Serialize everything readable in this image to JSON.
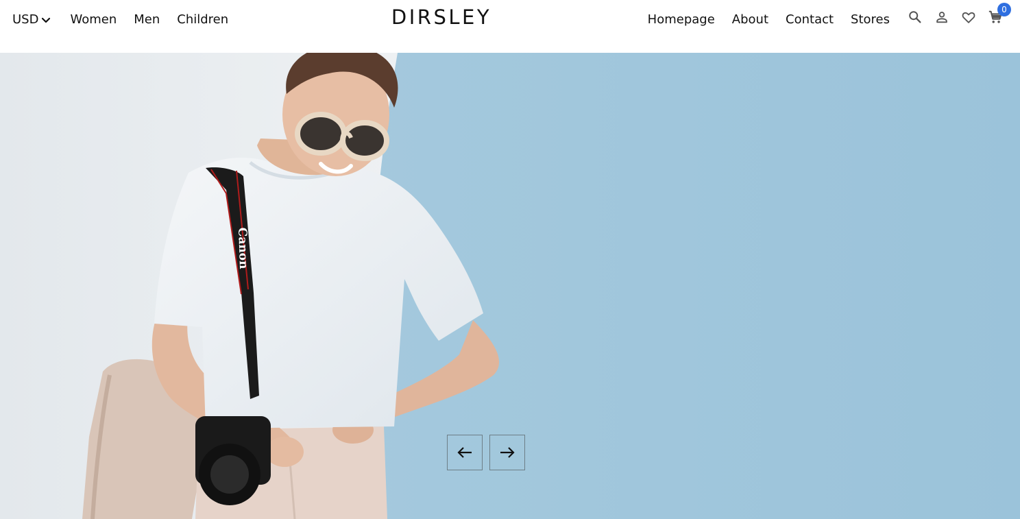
{
  "header": {
    "currency": {
      "label": "USD",
      "icon": "chevron-down-icon"
    },
    "left_nav": [
      {
        "label": "Women"
      },
      {
        "label": "Men"
      },
      {
        "label": "Children"
      }
    ],
    "brand": "DIRSLEY",
    "right_nav": [
      {
        "label": "Homepage"
      },
      {
        "label": "About"
      },
      {
        "label": "Contact"
      },
      {
        "label": "Stores"
      }
    ],
    "icons": {
      "search": "search-icon",
      "account": "user-icon",
      "wishlist": "heart-icon",
      "cart": "cart-icon"
    },
    "cart_count": "0",
    "badge_color": "#2f6fe0"
  },
  "hero": {
    "image": "Woman in white t-shirt and sunglasses with a camera strap and beige bag, smiling, standing against a light blue wall",
    "wall_colors": {
      "left": "#e8ecef",
      "right": "#9fc6dc"
    },
    "controls": {
      "prev": "arrow-left-icon",
      "next": "arrow-right-icon"
    }
  }
}
